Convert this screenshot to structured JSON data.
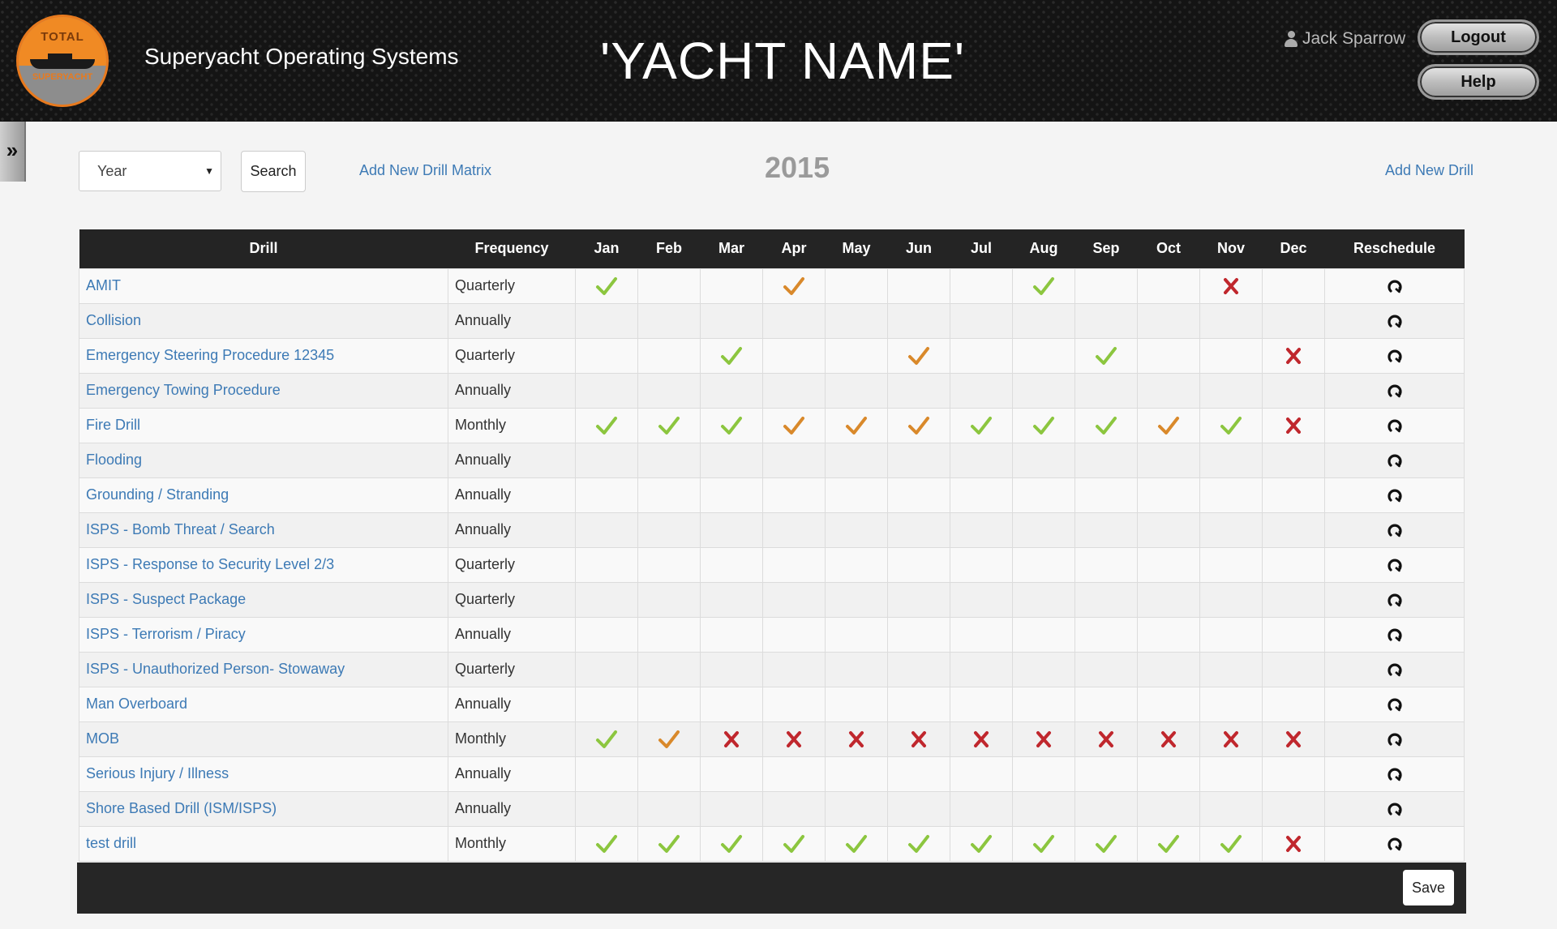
{
  "header": {
    "logo_top": "TOTAL",
    "logo_bottom": "SUPERYACHT",
    "app_title": "Superyacht Operating Systems",
    "yacht_name": "'YACHT NAME'",
    "user_name": "Jack Sparrow",
    "logout_label": "Logout",
    "help_label": "Help"
  },
  "sidebar_toggle": "»",
  "toolbar": {
    "year_select_value": "Year",
    "search_label": "Search",
    "add_matrix_label": "Add New Drill Matrix",
    "year_title": "2015",
    "add_drill_label": "Add New Drill"
  },
  "table": {
    "columns": [
      "Drill",
      "Frequency",
      "Jan",
      "Feb",
      "Mar",
      "Apr",
      "May",
      "Jun",
      "Jul",
      "Aug",
      "Sep",
      "Oct",
      "Nov",
      "Dec",
      "Reschedule"
    ],
    "rows": [
      {
        "drill": "AMIT",
        "frequency": "Quarterly",
        "marks": [
          "g",
          "",
          "",
          "o",
          "",
          "",
          "",
          "g",
          "",
          "",
          "x",
          ""
        ]
      },
      {
        "drill": "Collision",
        "frequency": "Annually",
        "marks": [
          "",
          "",
          "",
          "",
          "",
          "",
          "",
          "",
          "",
          "",
          "",
          ""
        ]
      },
      {
        "drill": "Emergency Steering Procedure 12345",
        "frequency": "Quarterly",
        "marks": [
          "",
          "",
          "g",
          "",
          "",
          "o",
          "",
          "",
          "g",
          "",
          "",
          "x"
        ]
      },
      {
        "drill": "Emergency Towing Procedure",
        "frequency": "Annually",
        "marks": [
          "",
          "",
          "",
          "",
          "",
          "",
          "",
          "",
          "",
          "",
          "",
          ""
        ]
      },
      {
        "drill": "Fire Drill",
        "frequency": "Monthly",
        "marks": [
          "g",
          "g",
          "g",
          "o",
          "o",
          "o",
          "g",
          "g",
          "g",
          "o",
          "g",
          "x"
        ]
      },
      {
        "drill": "Flooding",
        "frequency": "Annually",
        "marks": [
          "",
          "",
          "",
          "",
          "",
          "",
          "",
          "",
          "",
          "",
          "",
          ""
        ]
      },
      {
        "drill": "Grounding / Stranding",
        "frequency": "Annually",
        "marks": [
          "",
          "",
          "",
          "",
          "",
          "",
          "",
          "",
          "",
          "",
          "",
          ""
        ]
      },
      {
        "drill": "ISPS - Bomb Threat / Search",
        "frequency": "Annually",
        "marks": [
          "",
          "",
          "",
          "",
          "",
          "",
          "",
          "",
          "",
          "",
          "",
          ""
        ]
      },
      {
        "drill": "ISPS - Response to Security Level 2/3",
        "frequency": "Quarterly",
        "marks": [
          "",
          "",
          "",
          "",
          "",
          "",
          "",
          "",
          "",
          "",
          "",
          ""
        ]
      },
      {
        "drill": "ISPS - Suspect Package",
        "frequency": "Quarterly",
        "marks": [
          "",
          "",
          "",
          "",
          "",
          "",
          "",
          "",
          "",
          "",
          "",
          ""
        ]
      },
      {
        "drill": "ISPS - Terrorism / Piracy",
        "frequency": "Annually",
        "marks": [
          "",
          "",
          "",
          "",
          "",
          "",
          "",
          "",
          "",
          "",
          "",
          ""
        ]
      },
      {
        "drill": "ISPS - Unauthorized Person- Stowaway",
        "frequency": "Quarterly",
        "marks": [
          "",
          "",
          "",
          "",
          "",
          "",
          "",
          "",
          "",
          "",
          "",
          ""
        ]
      },
      {
        "drill": "Man Overboard",
        "frequency": "Annually",
        "marks": [
          "",
          "",
          "",
          "",
          "",
          "",
          "",
          "",
          "",
          "",
          "",
          ""
        ]
      },
      {
        "drill": "MOB",
        "frequency": "Monthly",
        "marks": [
          "g",
          "o",
          "x",
          "x",
          "x",
          "x",
          "x",
          "x",
          "x",
          "x",
          "x",
          "x"
        ]
      },
      {
        "drill": "Serious Injury / Illness",
        "frequency": "Annually",
        "marks": [
          "",
          "",
          "",
          "",
          "",
          "",
          "",
          "",
          "",
          "",
          "",
          ""
        ]
      },
      {
        "drill": "Shore Based Drill (ISM/ISPS)",
        "frequency": "Annually",
        "marks": [
          "",
          "",
          "",
          "",
          "",
          "",
          "",
          "",
          "",
          "",
          "",
          ""
        ]
      },
      {
        "drill": "test drill",
        "frequency": "Monthly",
        "marks": [
          "g",
          "g",
          "g",
          "g",
          "g",
          "g",
          "g",
          "g",
          "g",
          "g",
          "g",
          "x"
        ]
      }
    ]
  },
  "footer": {
    "save_label": "Save"
  },
  "colors": {
    "check_green": "#8cc63f",
    "check_orange": "#d9892b",
    "cross_red": "#c0272d",
    "link_blue": "#3d7ab5",
    "header_bg": "#141414"
  },
  "icons": {
    "g": "check-green-icon",
    "o": "check-orange-icon",
    "x": "cross-red-icon",
    "reschedule": "reschedule-icon"
  }
}
